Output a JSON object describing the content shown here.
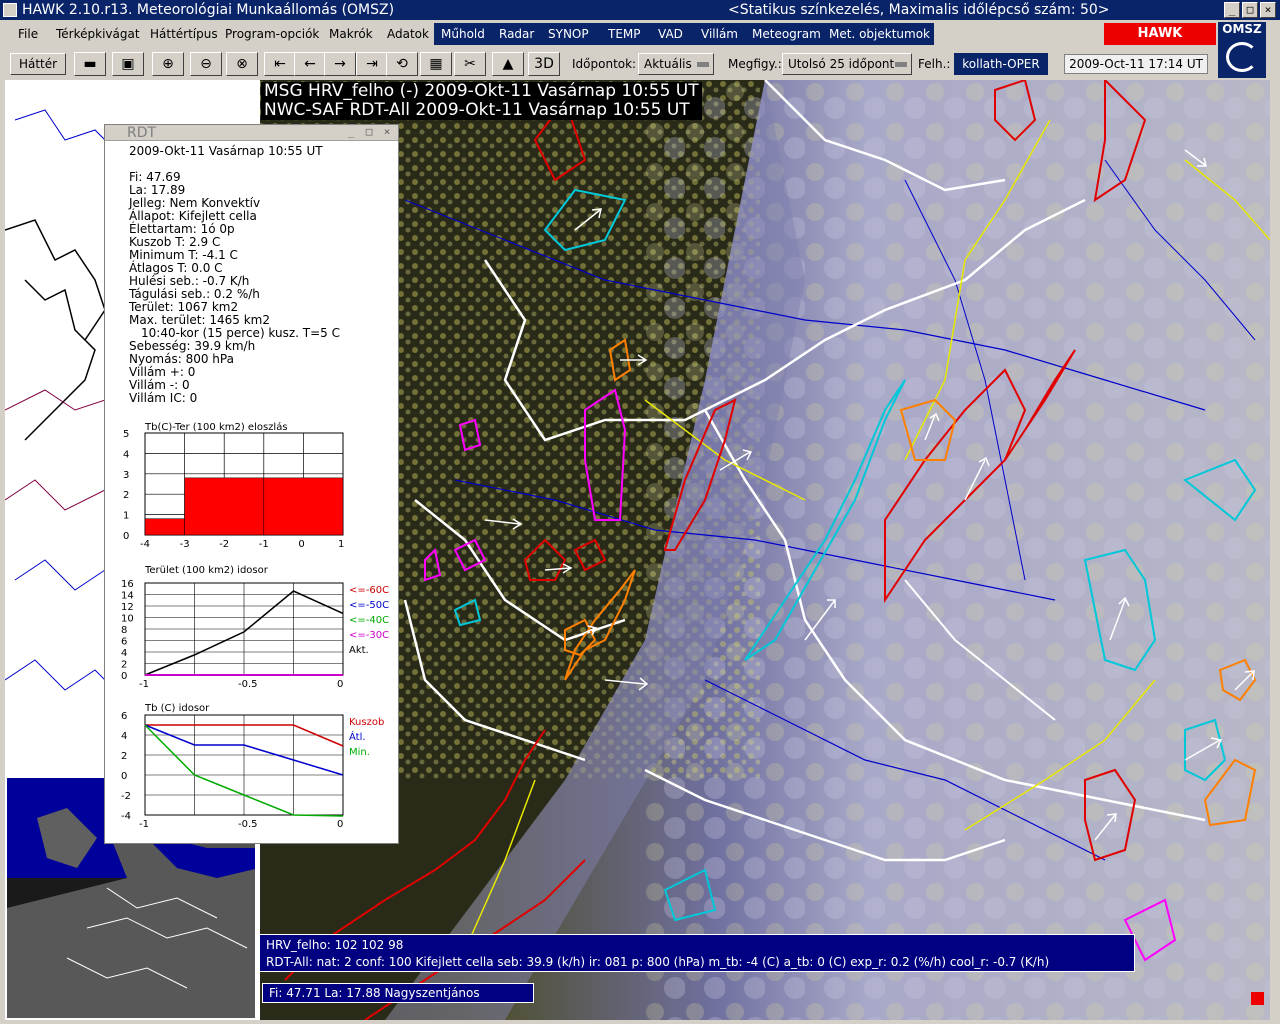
{
  "window": {
    "title_left": "HAWK 2.10.r13.  Meteorológiai Munkaállomás  (OMSZ)",
    "title_right": "<Statikus színkezelés,  Maximalis időlépcső  szám: 50>",
    "controls": [
      "_",
      "□",
      "×"
    ]
  },
  "menu": {
    "items": [
      "File",
      "Térképkivágat",
      "Háttértípus",
      "Program-opciók",
      "Makrók",
      "Adatok",
      "Műhold",
      "Radar",
      "SYNOP",
      "TEMP",
      "VAD",
      "Villám",
      "Meteogram",
      "Met. objektumok"
    ],
    "badge": "HAWK 2.10.r13.",
    "logo": "OMSZ"
  },
  "toolbar": {
    "hatter": "Háttér",
    "idopontok_label": "Időpontok:",
    "idopontok_value": "Aktuális",
    "megfigy_label": "Megfigy.:",
    "megfigy_value": "Utolsó 25 időpont",
    "felh_label": "Felh.:",
    "user": "kollath-OPER",
    "datetime": "2009-Oct-11   17:14  UT",
    "icons": [
      "truck-icon",
      "save-icon",
      "zoom-in-icon",
      "zoom-out-icon",
      "zoom-reset-icon",
      "step-first-icon",
      "step-back-icon",
      "step-forward-icon",
      "step-last-icon",
      "loop-icon",
      "layout-icon",
      "scissors-icon",
      "mountains-icon",
      "3d-icon"
    ]
  },
  "map": {
    "header_line1": "MSG  HRV_felho (-)  2009-Okt-11 Vasárnap 10:55 UT",
    "header_line2": "NWC-SAF RDT-All 2009-Okt-11 Vasárnap 10:55 UT"
  },
  "rdt": {
    "title": "RDT",
    "date": "2009-Okt-11 Vasárnap 10:55 UT",
    "lines": [
      "Fi: 47.69",
      "La: 17.89",
      "Jelleg: Nem Konvektív",
      "Állapot: Kifejlett cella",
      "Élettartam: 1ó 0p",
      "Kuszob T: 2.9 C",
      "Minimum T: -4.1 C",
      "Átlagos T: 0.0 C",
      "Hulési seb.: -0.7 K/h",
      "Tágulási seb.: 0.2 %/h",
      "Terület: 1067 km2",
      "Max. terület: 1465 km2",
      "10:40-kor (15 perce) kusz. T=5 C",
      "Sebesség: 39.9 km/h",
      "Nyomás: 800 hPa",
      "Villám +: 0",
      "Villám -: 0",
      "Villám IC: 0"
    ]
  },
  "chart_data": [
    {
      "type": "bar",
      "title": "Tb(C)-Ter (100 km2) eloszlás",
      "x_edges": [
        -4,
        -3,
        -2,
        -1,
        0,
        1
      ],
      "bars": [
        {
          "from": -4,
          "to": -3,
          "value": 0.8
        },
        {
          "from": -3,
          "to": -1,
          "value": 2.8
        },
        {
          "from": -1,
          "to": 1,
          "value": 2.8
        }
      ],
      "xticks": [
        "-4",
        "-3",
        "-2",
        "-1",
        "0",
        "1"
      ],
      "yticks": [
        "0",
        "1",
        "2",
        "3",
        "4",
        "5"
      ],
      "ylim": [
        0,
        5
      ],
      "color": "#ff0000"
    },
    {
      "type": "line",
      "title": "Terület (100 km2) idosor",
      "x": [
        -1,
        -0.75,
        -0.5,
        -0.25,
        0
      ],
      "series": [
        {
          "name": "Akt.",
          "values": [
            0,
            3.5,
            7.5,
            14.6,
            10.7
          ],
          "color": "#000000"
        }
      ],
      "legend": [
        {
          "label": "<=-60C",
          "color": "#cc0000"
        },
        {
          "label": "<=-50C",
          "color": "#0000cc"
        },
        {
          "label": "<=-40C",
          "color": "#00aa00"
        },
        {
          "label": "<=-30C",
          "color": "#cc00cc"
        },
        {
          "label": "Akt.",
          "color": "#000000"
        }
      ],
      "xticks": [
        "-1",
        "-0.5",
        "0"
      ],
      "yticks": [
        "0",
        "2",
        "4",
        "6",
        "8",
        "10",
        "12",
        "14",
        "16"
      ],
      "ylim": [
        0,
        16
      ]
    },
    {
      "type": "line",
      "title": "Tb (C) idosor",
      "x": [
        -1,
        -0.75,
        -0.5,
        -0.25,
        0
      ],
      "series": [
        {
          "name": "Kuszob",
          "values": [
            5,
            5,
            5,
            5,
            2.9
          ],
          "color": "#cc0000"
        },
        {
          "name": "Átl.",
          "values": [
            5,
            3,
            3,
            1.5,
            0
          ],
          "color": "#0000cc"
        },
        {
          "name": "Min.",
          "values": [
            5,
            0,
            -2,
            -4,
            -4.1
          ],
          "color": "#00aa00"
        }
      ],
      "xticks": [
        "-1",
        "-0.5",
        "0"
      ],
      "yticks": [
        "-4",
        "-2",
        "0",
        "2",
        "4",
        "6"
      ],
      "ylim": [
        -4,
        6
      ]
    }
  ],
  "info": {
    "line1": "HRV_felho: 102 102 98",
    "line2": "RDT-All:  nat: 2   conf: 100   Kifejlett cella   seb: 39.9 (k/h)   ir: 081   p: 800 (hPa)   m_tb: -4 (C)   a_tb: 0 (C)   exp_r: 0.2 (%/h)   cool_r: -0.7 (K/h)",
    "coord": "Fi:  47.71   La:   17.88   Nagyszentjános"
  },
  "colors": {
    "title_bg": "#0a246a",
    "accent_red": "#e00000",
    "info_bg": "#000080"
  }
}
